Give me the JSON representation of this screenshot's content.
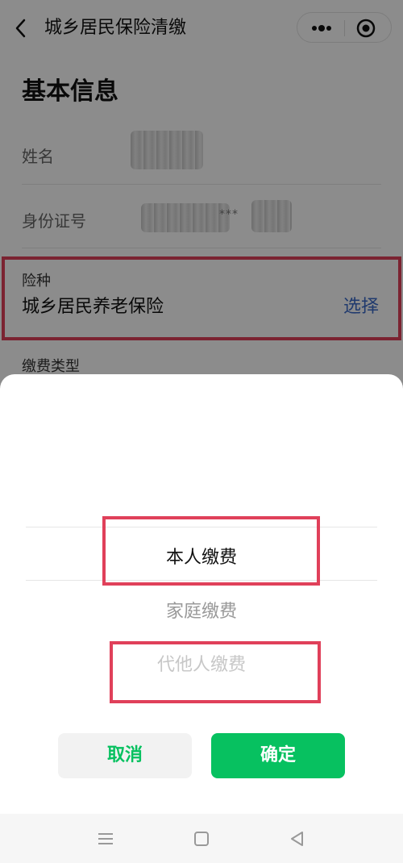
{
  "header": {
    "title": "城乡居民保险清缴",
    "back_icon": "chevron-left-icon",
    "more_icon": "more-dots-icon",
    "close_icon": "target-circle-icon"
  },
  "basic_info": {
    "section_title": "基本信息",
    "name_label": "姓名",
    "id_label": "身份证号",
    "id_masked_fragment": "***",
    "insurance_label": "险种",
    "insurance_value": "城乡居民养老保险",
    "insurance_select": "选择",
    "fee_type_label": "缴费类型"
  },
  "picker": {
    "options": [
      "本人缴费",
      "家庭缴费",
      "代他人缴费"
    ],
    "selected": "本人缴费",
    "cancel_label": "取消",
    "confirm_label": "确定"
  },
  "colors": {
    "accent_green": "#07c160",
    "link_blue": "#3b6bc8",
    "highlight_red": "#e0405a"
  },
  "navbar": {
    "icons": [
      "menu-icon",
      "home-square-icon",
      "back-triangle-icon"
    ]
  }
}
